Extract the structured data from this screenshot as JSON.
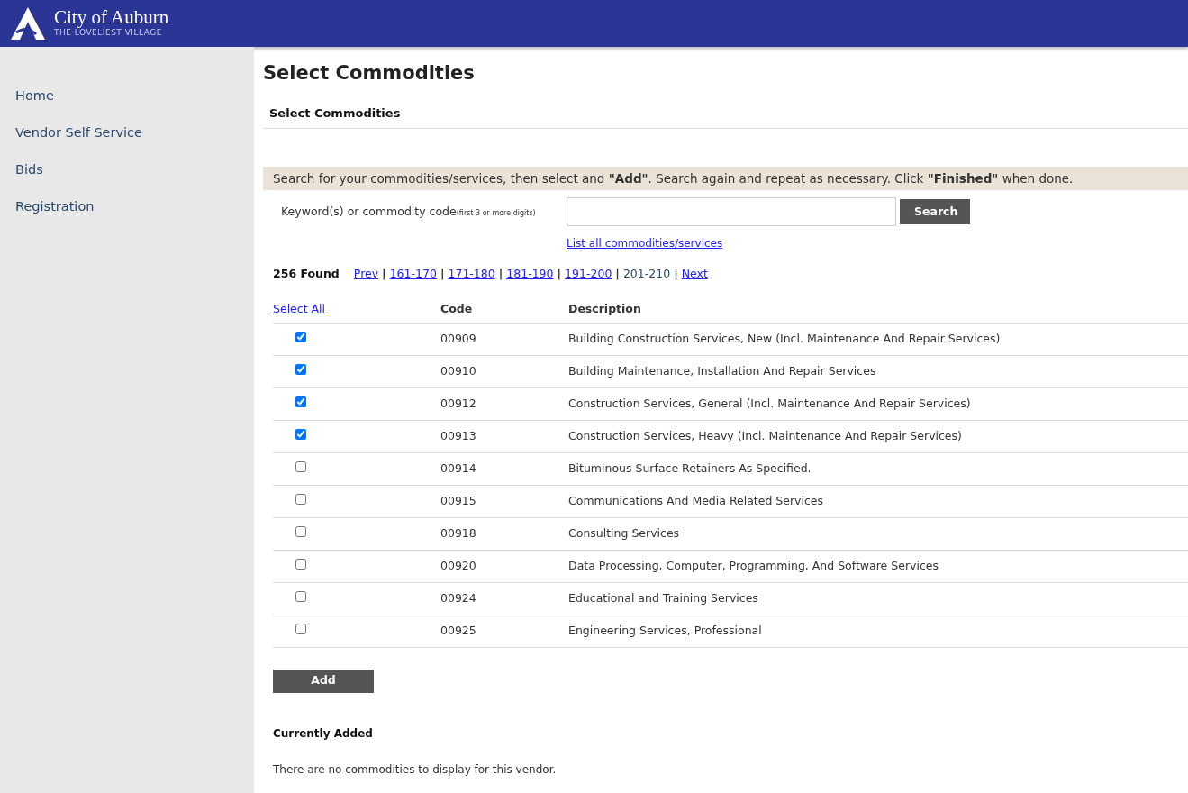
{
  "header": {
    "title": "City of Auburn",
    "tagline": "THE LOVELIEST VILLAGE"
  },
  "sidebar": {
    "items": [
      {
        "label": "Home"
      },
      {
        "label": "Vendor Self Service"
      },
      {
        "label": "Bids"
      },
      {
        "label": "Registration"
      }
    ]
  },
  "page_title": "Select Commodities",
  "section_title": "Select Commodities",
  "instructions": "Search for your commodities/services, then select and **\"Add\"**. Search again and repeat as necessary. Click **\"Finished\"** when done.",
  "search": {
    "label": "Keyword(s) or commodity code",
    "hint": "(first 3 or more digits)",
    "button": "Search",
    "list_all_link": "List all commodities/services"
  },
  "results": {
    "found": "256 Found",
    "pages": [
      {
        "label": "Prev",
        "selected": false
      },
      {
        "separator": "|",
        "label": "161-170",
        "selected": false
      },
      {
        "separator": "|",
        "label": "171-180",
        "selected": false
      },
      {
        "separator": "|",
        "label": "181-190",
        "selected": false
      },
      {
        "separator": "|",
        "label": "191-200",
        "selected": false
      },
      {
        "separator": "|",
        "label": "201-210",
        "selected": true
      },
      {
        "separator": "|",
        "label": "Next",
        "selected": false
      }
    ]
  },
  "table": {
    "select_all": "Select All",
    "columns": [
      "Code",
      "Description"
    ],
    "rows": [
      {
        "checked": true,
        "code": "00909",
        "description": "Building Construction Services, New (Incl. Maintenance And Repair Services)"
      },
      {
        "checked": true,
        "code": "00910",
        "description": "Building Maintenance, Installation And Repair Services"
      },
      {
        "checked": true,
        "code": "00912",
        "description": "Construction Services, General (Incl. Maintenance And Repair Services)"
      },
      {
        "checked": true,
        "code": "00913",
        "description": "Construction Services, Heavy (Incl. Maintenance And Repair Services)"
      },
      {
        "checked": false,
        "code": "00914",
        "description": "Bituminous Surface Retainers As Specified."
      },
      {
        "checked": false,
        "code": "00915",
        "description": "Communications And Media Related Services"
      },
      {
        "checked": false,
        "code": "00918",
        "description": "Consulting Services"
      },
      {
        "checked": false,
        "code": "00920",
        "description": "Data Processing, Computer, Programming, And Software Services"
      },
      {
        "checked": false,
        "code": "00924",
        "description": "Educational and Training Services"
      },
      {
        "checked": false,
        "code": "00925",
        "description": "Engineering Services, Professional"
      }
    ]
  },
  "add_button": "Add",
  "currently_added": {
    "title": "Currently Added",
    "message": "There are no commodities to display for this vendor."
  }
}
